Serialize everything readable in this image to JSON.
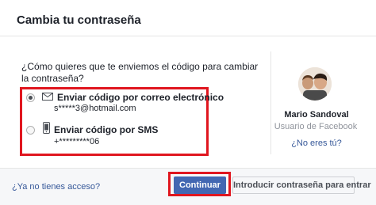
{
  "dialog": {
    "title": "Cambia tu contraseña"
  },
  "recovery": {
    "question": "¿Cómo quieres que te enviemos el código para cambiar la contraseña?",
    "options": [
      {
        "label": "Enviar código por correo electrónico",
        "detail": "s*****3@hotmail.com",
        "icon": "mail-icon",
        "selected": true
      },
      {
        "label": "Enviar código por SMS",
        "detail": "+*********06",
        "icon": "phone-icon",
        "selected": false
      }
    ]
  },
  "profile": {
    "name": "Mario Sandoval",
    "subtitle": "Usuario de Facebook",
    "not_you_link": "¿No eres tú?"
  },
  "footer": {
    "no_access_link": "¿Ya no tienes acceso?",
    "continue_label": "Continuar",
    "enter_password_label": "Introducir contraseña para entrar"
  },
  "colors": {
    "primary": "#4267b2",
    "link": "#365899",
    "highlight": "#e0161f",
    "footer_bg": "#f6f7f9"
  }
}
